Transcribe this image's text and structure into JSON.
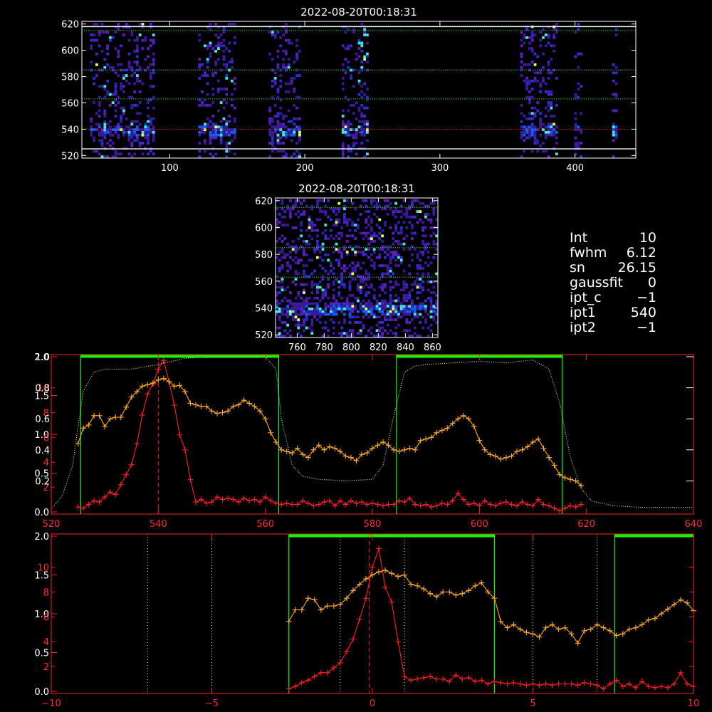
{
  "colors": {
    "green": "#00ff00",
    "orange": "#ffa830",
    "red": "#ff2020",
    "cool": "#00e0e0",
    "pale": "#ffffc0"
  },
  "stats": [
    {
      "label": "Int",
      "value": "10"
    },
    {
      "label": "fwhm",
      "value": "6.12"
    },
    {
      "label": "sn",
      "value": "26.15"
    },
    {
      "label": "gaussfit",
      "value": "0"
    },
    {
      "label": "ipt_c",
      "value": "−1"
    },
    {
      "label": "ipt1",
      "value": "540"
    },
    {
      "label": "ipt2",
      "value": "−1"
    }
  ],
  "chart_data": [
    {
      "type": "heatmap",
      "title": "2022-08-20T00:18:31",
      "xlim": [
        35,
        445
      ],
      "ylim": [
        518,
        622
      ],
      "x_ticks": [
        "100",
        "200",
        "300",
        "400"
      ],
      "x_tick_values": [
        100,
        200,
        300,
        400
      ],
      "y_ticks": [
        "520",
        "540",
        "560",
        "580",
        "600",
        "620"
      ],
      "y_tick_values": [
        520,
        540,
        560,
        580,
        600,
        620
      ],
      "white_lines_y": [
        525,
        618
      ],
      "green_dotted_y": [
        563,
        585,
        615
      ],
      "red_dotted_y": [
        540
      ],
      "bands": [
        [
          40,
          88
        ],
        [
          120,
          148
        ],
        [
          172,
          196
        ],
        [
          226,
          246
        ],
        [
          358,
          386
        ],
        [
          398,
          405
        ],
        [
          427,
          431
        ]
      ]
    },
    {
      "type": "heatmap",
      "title": "2022-08-20T00:18:31",
      "xlim": [
        744,
        864
      ],
      "ylim": [
        518,
        622
      ],
      "x_ticks": [
        "760",
        "780",
        "800",
        "820",
        "840",
        "860"
      ],
      "x_tick_values": [
        760,
        780,
        800,
        820,
        840,
        860
      ],
      "y_ticks": [
        "520",
        "540",
        "560",
        "580",
        "600",
        "620"
      ],
      "y_tick_values": [
        520,
        540,
        560,
        580,
        600,
        620
      ],
      "green_dotted_y": [
        563,
        585,
        615
      ]
    },
    {
      "type": "line",
      "xlim": [
        520,
        640
      ],
      "x_ticks": [
        "520",
        "540",
        "560",
        "580",
        "600",
        "620",
        "640"
      ],
      "x_tick_values": [
        520,
        540,
        560,
        580,
        600,
        620,
        640
      ],
      "left_ticks_red": [
        "2",
        "4",
        "6",
        "8",
        "10"
      ],
      "left_tick_values_red": [
        2,
        4,
        6,
        8,
        10
      ],
      "left_ticks_orange": [
        "0.0",
        "0.5",
        "1.0",
        "1.5",
        "2.0"
      ],
      "left_ticks_white": [
        "0.2",
        "0.4",
        "0.6",
        "0.8",
        "1.0"
      ],
      "green_vlines": [
        525.5,
        562.5,
        584.5,
        615.5
      ],
      "green_bars": [
        [
          525.5,
          562.5
        ],
        [
          584.5,
          615.5
        ]
      ],
      "red_dashed_x": 540,
      "series": [
        {
          "color": "red",
          "x": [
            525,
            526,
            527,
            528,
            529,
            530,
            531,
            532,
            533,
            534,
            535,
            536,
            537,
            538,
            539,
            540,
            541,
            542,
            543,
            544,
            545,
            546,
            547,
            548,
            549,
            550,
            551,
            552,
            553,
            554,
            555,
            556,
            557,
            558,
            559,
            560,
            561,
            562,
            563,
            564,
            565,
            566,
            567,
            568,
            569,
            570,
            571,
            572,
            573,
            574,
            575,
            576,
            577,
            578,
            579,
            580,
            581,
            582,
            583,
            584,
            585,
            586,
            587,
            588,
            589,
            590,
            591,
            592,
            593,
            594,
            595,
            596,
            597,
            598,
            599,
            600,
            601,
            602,
            603,
            604,
            605,
            606,
            607,
            608,
            609,
            610,
            611,
            612,
            613,
            614,
            615,
            616,
            617,
            618,
            619
          ],
          "values": [
            0.4,
            0.3,
            0.6,
            0.9,
            0.8,
            1.2,
            1.6,
            1.4,
            2.2,
            3.0,
            3.8,
            5.5,
            7.8,
            9.5,
            10.3,
            11.5,
            12.2,
            10.5,
            8.6,
            6.2,
            5.0,
            2.6,
            0.8,
            1.0,
            0.7,
            0.8,
            1.2,
            1.0,
            1.1,
            1.0,
            0.8,
            1.1,
            0.9,
            1.0,
            0.8,
            1.2,
            0.9,
            0.7,
            0.6,
            0.7,
            0.6,
            0.6,
            0.9,
            0.7,
            0.5,
            0.6,
            0.8,
            0.9,
            0.5,
            0.9,
            0.6,
            0.9,
            0.7,
            0.8,
            0.6,
            0.7,
            0.6,
            0.5,
            0.6,
            0.6,
            0.9,
            0.8,
            1.1,
            0.6,
            0.5,
            0.6,
            0.4,
            0.5,
            0.7,
            0.6,
            0.9,
            1.5,
            1.0,
            0.6,
            0.7,
            0.5,
            0.9,
            0.6,
            0.5,
            0.7,
            0.8,
            0.6,
            0.5,
            0.8,
            0.6,
            0.5,
            1.0,
            0.6,
            0.5,
            0.3,
            0.1,
            0.3,
            0.5,
            0.4,
            0.6
          ]
        },
        {
          "color": "orange",
          "x": [
            525,
            526,
            527,
            528,
            529,
            530,
            531,
            532,
            533,
            534,
            535,
            536,
            537,
            538,
            539,
            540,
            541,
            542,
            543,
            544,
            545,
            546,
            547,
            548,
            549,
            550,
            551,
            552,
            553,
            554,
            555,
            556,
            557,
            558,
            559,
            560,
            561,
            562,
            563,
            564,
            565,
            566,
            567,
            568,
            569,
            570,
            571,
            572,
            573,
            574,
            575,
            576,
            577,
            578,
            579,
            580,
            581,
            582,
            583,
            584,
            585,
            586,
            587,
            588,
            589,
            590,
            591,
            592,
            593,
            594,
            595,
            596,
            597,
            598,
            599,
            600,
            601,
            602,
            603,
            604,
            605,
            606,
            607,
            608,
            609,
            610,
            611,
            612,
            613,
            614,
            615,
            616,
            617,
            618,
            619
          ],
          "values": [
            0.88,
            1.08,
            1.12,
            1.24,
            1.24,
            1.1,
            1.2,
            1.22,
            1.22,
            1.35,
            1.48,
            1.55,
            1.62,
            1.64,
            1.66,
            1.7,
            1.72,
            1.68,
            1.62,
            1.63,
            1.55,
            1.4,
            1.38,
            1.36,
            1.36,
            1.3,
            1.27,
            1.28,
            1.3,
            1.36,
            1.38,
            1.44,
            1.4,
            1.36,
            1.3,
            1.2,
            1.02,
            0.9,
            0.8,
            0.78,
            0.76,
            0.82,
            0.74,
            0.7,
            0.8,
            0.86,
            0.8,
            0.84,
            0.82,
            0.78,
            0.72,
            0.7,
            0.66,
            0.74,
            0.76,
            0.82,
            0.86,
            0.9,
            0.86,
            0.8,
            0.78,
            0.8,
            0.82,
            0.8,
            0.92,
            0.94,
            0.96,
            1.02,
            1.05,
            1.08,
            1.14,
            1.2,
            1.24,
            1.2,
            1.1,
            0.92,
            0.8,
            0.74,
            0.72,
            0.68,
            0.7,
            0.72,
            0.78,
            0.8,
            0.84,
            0.9,
            0.94,
            0.82,
            0.7,
            0.6,
            0.48,
            0.44,
            0.42,
            0.4,
            0.34
          ]
        },
        {
          "color": "pale",
          "x": [
            520,
            522,
            524,
            525,
            526,
            528,
            530,
            535,
            540,
            545,
            550,
            555,
            560,
            562,
            563,
            565,
            567,
            570,
            575,
            580,
            582,
            584,
            586,
            588,
            590,
            595,
            600,
            605,
            610,
            613,
            615,
            617,
            619,
            621,
            625,
            630,
            640
          ],
          "values": [
            0.02,
            0.1,
            0.3,
            0.55,
            0.78,
            0.9,
            0.92,
            0.92,
            0.95,
            0.99,
            1.0,
            1.0,
            1.0,
            0.92,
            0.6,
            0.3,
            0.23,
            0.21,
            0.2,
            0.21,
            0.3,
            0.62,
            0.9,
            0.94,
            0.95,
            0.96,
            0.97,
            0.96,
            0.98,
            0.92,
            0.7,
            0.35,
            0.15,
            0.07,
            0.04,
            0.03,
            0.03
          ]
        }
      ]
    },
    {
      "type": "line",
      "xlim": [
        -10,
        10
      ],
      "x_ticks": [
        "−10",
        "−5",
        "0",
        "5",
        "10"
      ],
      "x_tick_values": [
        -10,
        -5,
        0,
        5,
        10
      ],
      "left_ticks_red": [
        "2",
        "4",
        "6",
        "8",
        "10"
      ],
      "left_ticks_orange": [
        "0.0",
        "0.5",
        "1.0",
        "1.5",
        "2.0"
      ],
      "green_vlines": [
        -2.6,
        3.8,
        7.55
      ],
      "green_bars": [
        [
          -2.6,
          3.8
        ],
        [
          7.55,
          10
        ]
      ],
      "white_dotted_x": [
        -7,
        -5,
        -1,
        1,
        5,
        7
      ],
      "red_dashed_x": -0.1,
      "series": [
        {
          "color": "red",
          "x": [
            -2.6,
            -2.4,
            -2.2,
            -2.0,
            -1.8,
            -1.6,
            -1.4,
            -1.2,
            -1.0,
            -0.8,
            -0.6,
            -0.4,
            -0.2,
            0.0,
            0.2,
            0.4,
            0.6,
            0.8,
            1.0,
            1.2,
            1.4,
            1.6,
            1.8,
            2.0,
            2.2,
            2.4,
            2.6,
            2.8,
            3.0,
            3.2,
            3.4,
            3.6,
            3.8,
            4.0,
            4.2,
            4.4,
            4.6,
            4.8,
            5.0,
            5.2,
            5.4,
            5.6,
            5.8,
            6.0,
            6.2,
            6.4,
            6.6,
            6.8,
            7.0,
            7.2,
            7.4,
            7.6,
            7.8,
            8.0,
            8.2,
            8.4,
            8.6,
            8.8,
            9.0,
            9.2,
            9.4,
            9.6,
            9.8,
            10.0
          ],
          "values": [
            0.2,
            0.4,
            0.7,
            0.9,
            1.2,
            1.5,
            1.5,
            1.9,
            2.3,
            3.2,
            4.2,
            5.8,
            7.5,
            10.0,
            11.5,
            8.4,
            7.2,
            4.0,
            1.2,
            0.9,
            1.0,
            1.1,
            1.2,
            1.0,
            1.0,
            0.8,
            1.3,
            1.0,
            1.1,
            0.8,
            0.9,
            0.6,
            0.8,
            0.7,
            0.6,
            0.7,
            0.6,
            0.5,
            0.6,
            0.5,
            0.6,
            0.5,
            0.6,
            0.6,
            0.6,
            0.5,
            0.7,
            0.6,
            0.5,
            0.2,
            0.6,
            0.9,
            0.4,
            0.6,
            0.3,
            0.8,
            0.4,
            0.3,
            0.4,
            0.3,
            0.6,
            1.5,
            0.6,
            0.4
          ]
        },
        {
          "color": "orange",
          "x": [
            -2.6,
            -2.4,
            -2.2,
            -2.0,
            -1.8,
            -1.6,
            -1.4,
            -1.2,
            -1.0,
            -0.8,
            -0.6,
            -0.4,
            -0.2,
            0.0,
            0.2,
            0.4,
            0.6,
            0.8,
            1.0,
            1.2,
            1.4,
            1.6,
            1.8,
            2.0,
            2.2,
            2.4,
            2.6,
            2.8,
            3.0,
            3.2,
            3.4,
            3.6,
            3.8,
            4.0,
            4.2,
            4.4,
            4.6,
            4.8,
            5.0,
            5.2,
            5.4,
            5.6,
            5.8,
            6.0,
            6.2,
            6.4,
            6.6,
            6.8,
            7.0,
            7.2,
            7.4,
            7.6,
            7.8,
            8.0,
            8.2,
            8.4,
            8.6,
            8.8,
            9.0,
            9.2,
            9.4,
            9.6,
            9.8,
            10.0
          ],
          "values": [
            0.9,
            1.05,
            1.05,
            1.2,
            1.18,
            1.05,
            1.1,
            1.1,
            1.12,
            1.2,
            1.3,
            1.38,
            1.45,
            1.5,
            1.54,
            1.56,
            1.52,
            1.48,
            1.5,
            1.38,
            1.36,
            1.32,
            1.26,
            1.22,
            1.28,
            1.28,
            1.24,
            1.26,
            1.3,
            1.36,
            1.4,
            1.28,
            1.2,
            0.9,
            0.82,
            0.86,
            0.8,
            0.76,
            0.74,
            0.7,
            0.82,
            0.86,
            0.8,
            0.82,
            0.74,
            0.62,
            0.78,
            0.8,
            0.86,
            0.82,
            0.78,
            0.72,
            0.74,
            0.8,
            0.82,
            0.86,
            0.92,
            0.94,
            1.0,
            1.06,
            1.12,
            1.18,
            1.14,
            1.04
          ]
        }
      ]
    }
  ]
}
